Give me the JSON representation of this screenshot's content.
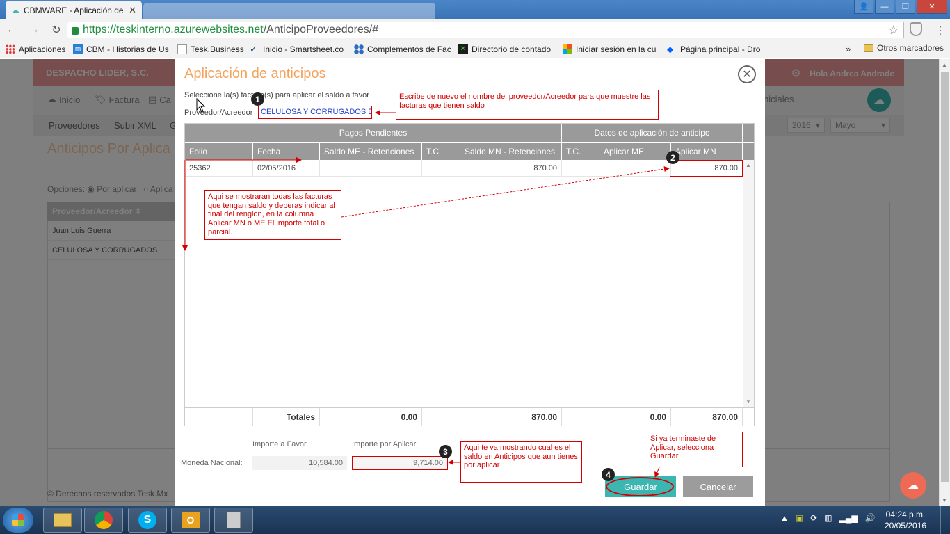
{
  "browser": {
    "tab_title": "CBMWARE - Aplicación de",
    "url_host": "https://teskinterno.azurewebsites.net",
    "url_path": "/AnticipoProveedores/#",
    "bookmarks": [
      {
        "label": "Aplicaciones",
        "icon": "apps-grid-icon"
      },
      {
        "label": "CBM - Historias de Us",
        "icon": "cbm-icon"
      },
      {
        "label": "Tesk.Business",
        "icon": "page-icon"
      },
      {
        "label": "Inicio - Smartsheet.co",
        "icon": "check-icon"
      },
      {
        "label": "Complementos de Fac",
        "icon": "puzzle-icon"
      },
      {
        "label": "Directorio de contado",
        "icon": "excel-icon"
      },
      {
        "label": "Iniciar sesión en la cu",
        "icon": "windows-icon"
      },
      {
        "label": "Página principal - Dro",
        "icon": "dropbox-icon"
      }
    ],
    "other_bookmarks": "Otros marcadores"
  },
  "app": {
    "brand": "DESPACHO LIDER, S.C.",
    "greeting": "Hola Andrea Andrade",
    "menu": [
      "Inicio",
      "Factura",
      "Ca",
      "niciales"
    ],
    "submenu": [
      "Proveedores",
      "Subir XML",
      "G"
    ],
    "year": "2016",
    "month": "Mayo",
    "page_title": "Anticipos Por Aplica",
    "options_label": "Opciones:",
    "options": [
      "Por aplicar",
      "Aplica"
    ],
    "grid_header": "Proveedor/Acreedor",
    "grid_rows": [
      "Juan Luis Guerra",
      "CELULOSA Y CORRUGADOS"
    ],
    "copyright": "© Derechos reservados Tesk.Mx"
  },
  "modal": {
    "title": "Aplicación de anticipos",
    "instruction": "Seleccione la(s) factura(s) para aplicar el saldo a favor",
    "provider_label": "Proveedor/Acreedor",
    "provider_value": "CELULOSA Y CORRUGADOS DE",
    "group_pending": "Pagos Pendientes",
    "group_application": "Datos de aplicación de anticipo",
    "columns": [
      "Folio",
      "Fecha",
      "Saldo ME - Retenciones",
      "T.C.",
      "Saldo MN - Retenciones",
      "T.C.",
      "Aplicar ME",
      "Aplicar MN"
    ],
    "rows": [
      {
        "folio": "25362",
        "fecha": "02/05/2016",
        "saldo_me": "",
        "tc": "",
        "saldo_mn": "870.00",
        "tc2": "",
        "aplicar_me": "",
        "aplicar_mn": "870.00"
      }
    ],
    "totals": {
      "label": "Totales",
      "saldo_me": "0.00",
      "saldo_mn": "870.00",
      "aplicar_me": "0.00",
      "aplicar_mn": "870.00"
    },
    "importe_favor_label": "Importe a Favor",
    "importe_aplicar_label": "Importe por Aplicar",
    "moneda_label": "Moneda Nacional:",
    "importe_favor": "10,584.00",
    "importe_aplicar": "9,714.00",
    "save_label": "Guardar",
    "cancel_label": "Cancelar"
  },
  "annotations": {
    "n1": "1",
    "n2": "2",
    "n3": "3",
    "n4": "4",
    "c1": "Escribe de nuevo el nombre del proveedor/Acreedor para que muestre las facturas que tienen saldo",
    "c2": "Aqui se mostraran todas las facturas que tengan saldo y deberas indicar al final del renglon, en la columna Aplicar MN o ME El importe total o parcial.",
    "c3": "Aqui te va mostrando cual es el saldo en Anticipos que aun tienes por aplicar",
    "c4": "Si ya terminaste de Aplicar, selecciona Guardar"
  },
  "taskbar": {
    "time": "04:24 p.m.",
    "date": "20/05/2016"
  },
  "colors": {
    "accent_teal": "#3bb6b0",
    "header_salmon": "#f19a9a",
    "annotation_red": "#d40000",
    "modal_title_orange": "#f3a35c"
  }
}
